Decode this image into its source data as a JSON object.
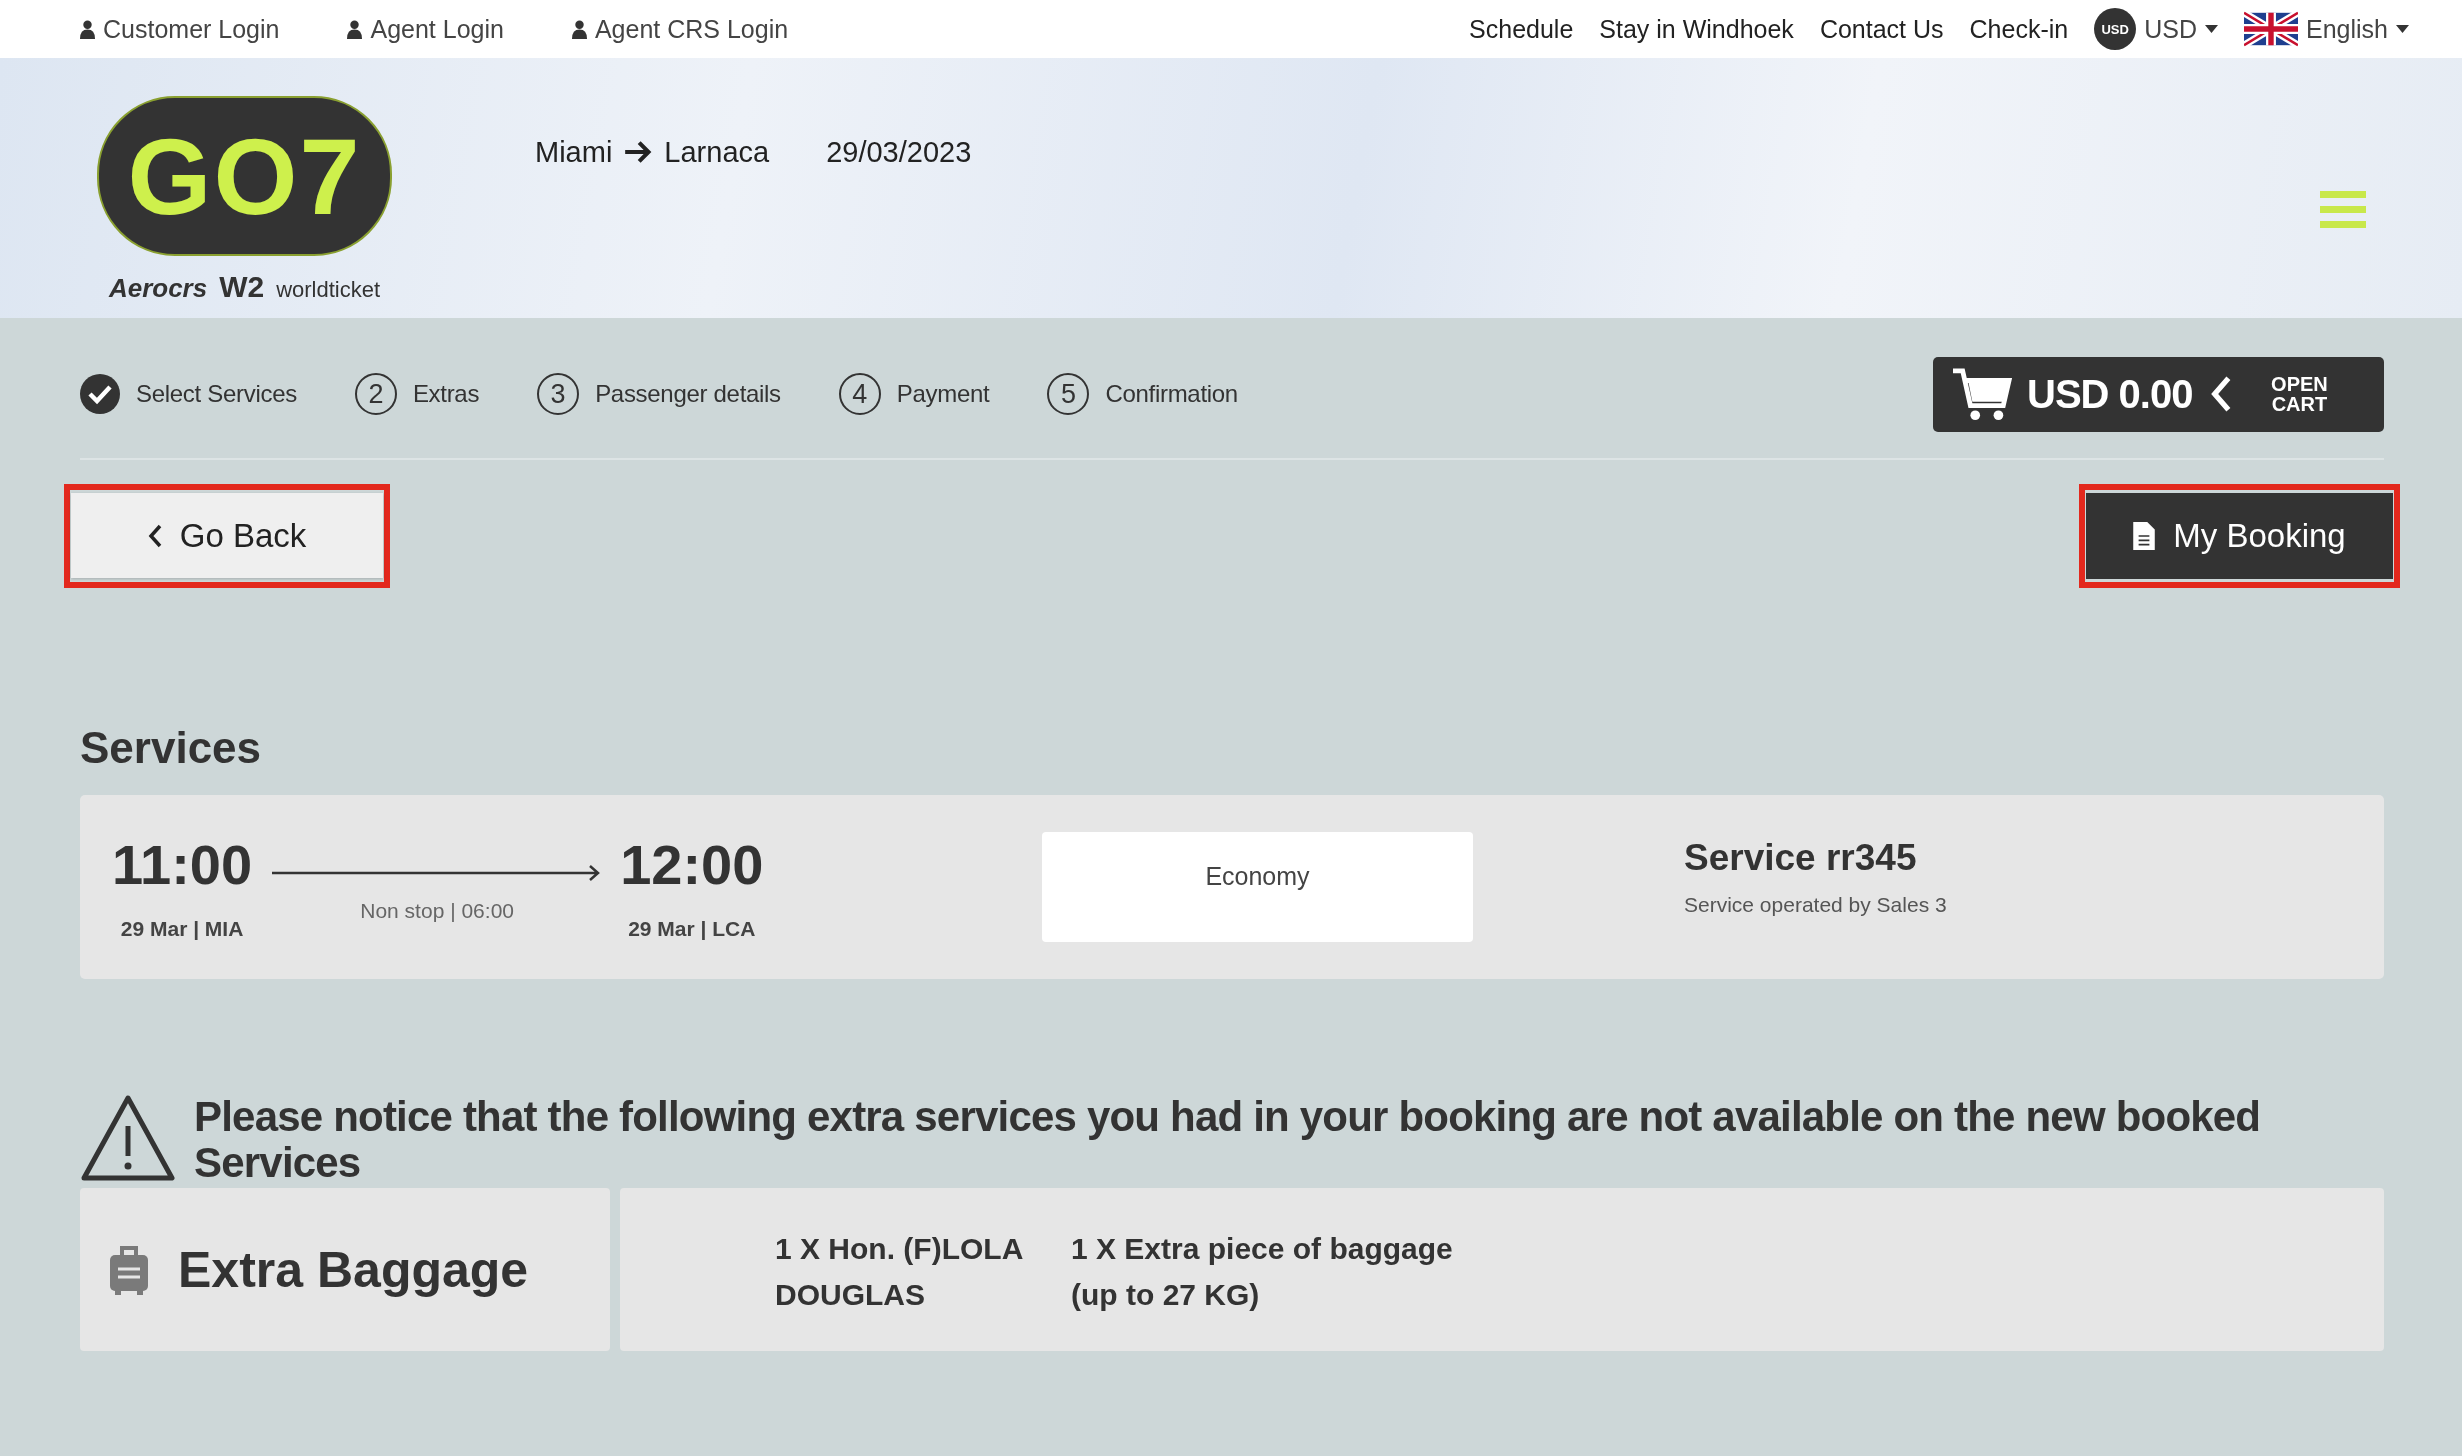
{
  "top_bar": {
    "left_links": [
      "Customer Login",
      "Agent Login",
      "Agent CRS Login"
    ],
    "right_links": [
      "Schedule",
      "Stay in Windhoek",
      "Contact Us",
      "Check-in"
    ],
    "currency": {
      "badge": "USD",
      "label": "USD"
    },
    "language": "English"
  },
  "header": {
    "logo": {
      "text": "GO7",
      "partners": [
        "Aerocrs",
        "W2",
        "worldticket"
      ]
    },
    "route": {
      "from": "Miami",
      "to": "Larnaca"
    },
    "date": "29/03/2023"
  },
  "steps": [
    {
      "label": "Select Services",
      "done": true
    },
    {
      "number": "2",
      "label": "Extras",
      "done": false
    },
    {
      "number": "3",
      "label": "Passenger details",
      "done": false
    },
    {
      "number": "4",
      "label": "Payment",
      "done": false
    },
    {
      "number": "5",
      "label": "Confirmation",
      "done": false
    }
  ],
  "cart": {
    "amount": "USD 0.00",
    "action": "OPEN CART"
  },
  "buttons": {
    "back": "Go Back",
    "booking": "My Booking"
  },
  "services": {
    "heading": "Services",
    "flight": {
      "departure_time": "11:00",
      "departure_info": "29 Mar | MIA",
      "duration": "Non stop | 06:00",
      "arrival_time": "12:00",
      "arrival_info": "29 Mar | LCA",
      "cabin": "Economy",
      "service_name": "Service rr345",
      "operator": "Service operated by Sales 3"
    }
  },
  "notice": {
    "text": "Please notice that the following extra services you had in your booking are not available on the new booked Services",
    "extra": {
      "title": "Extra Baggage",
      "passenger": "1 X Hon. (F)LOLA DOUGLAS",
      "item": "1 X Extra piece of baggage (up to 27 KG)"
    }
  }
}
